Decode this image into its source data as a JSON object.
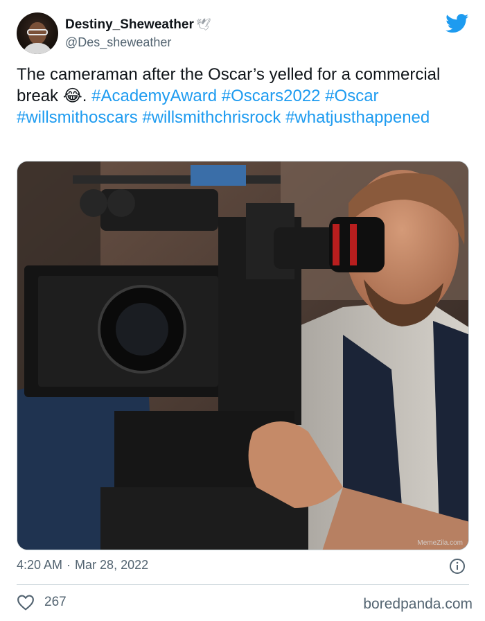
{
  "author": {
    "display_name": "Destiny_Sheweather",
    "name_emoji": "🕊",
    "handle": "@Des_sheweather",
    "avatar_icon": "profile-avatar"
  },
  "tweet": {
    "text_plain": "The cameraman after the Oscar’s yelled for a commercial break",
    "emoji": "😂",
    "after_emoji": ".",
    "hashtags": [
      "#AcademyAward",
      "#Oscars2022",
      "#Oscar",
      "#willsmithoscars",
      "#willsmithchrisrock",
      "#whatjusthappened"
    ]
  },
  "media": {
    "watermark": "MemeZila.com"
  },
  "meta": {
    "time": "4:20 AM",
    "separator": "·",
    "date": "Mar 28, 2022"
  },
  "engagement": {
    "likes": "267"
  },
  "source": "boredpanda.com",
  "colors": {
    "link": "#1d9bf0",
    "twitter_blue": "#1d9bf0",
    "muted": "#536471"
  },
  "icons": {
    "brand": "twitter-bird-icon",
    "info": "info-icon",
    "like": "heart-icon"
  }
}
